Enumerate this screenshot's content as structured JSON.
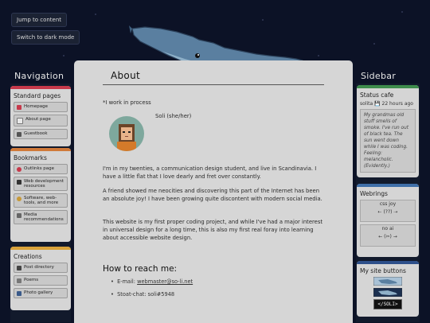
{
  "header": {
    "skip_label": "Jump to content",
    "dark_label": "Switch to dark mode"
  },
  "nav": {
    "title": "Navigation",
    "standard": {
      "title": "Standard pages",
      "items": [
        "Homepage",
        "About page",
        "Guestbook"
      ]
    },
    "bookmarks": {
      "title": "Bookmarks",
      "items": [
        "Outlinks page",
        "Web development resources",
        "Software, web-tools, and more",
        "Media recommendations"
      ]
    },
    "creations": {
      "title": "Creations",
      "items": [
        "Post directory",
        "Poems",
        "Photo gallery"
      ]
    }
  },
  "main": {
    "title": "About",
    "wip": "*I work in process",
    "avatar_caption": "Soli (she/her)",
    "para1": "I'm in my twenties, a communication design student, and live in Scandinavia. I have a little flat that I love dearly and fret over constantly.",
    "para2": "A friend showed me neocities and discovering this part of the Internet has been an absolute joy! I have been growing quite discontent with modern social media.",
    "para3": "This website is my first proper coding project, and while I've had a major interest in universal design for a long time, this is also my first real foray into learning about accessible website design.",
    "reach_title": "How to reach me:",
    "email_prefix": "E-mail: ",
    "email": "webmaster@so-li.net",
    "stoat": "Stoat-chat: soli#5948"
  },
  "sidebar": {
    "title": "Sidebar",
    "status": {
      "title": "Status cafe",
      "user": "solita",
      "time": "22 hours ago",
      "text": "My grandmas old stuff smells of smoke. I've run out of black tea. The sun went down while I was coding. Feeling: melancholic. (Evidently.)"
    },
    "webrings": {
      "title": "Webrings",
      "ring1_name": "css joy",
      "ring1_nav": "⇠ (??) ⇢",
      "ring2_name": "no ai",
      "ring2_nav": "← (✂) →"
    },
    "buttons": {
      "title": "My site buttons",
      "button3_text": "</SOLI>"
    }
  },
  "colors": {
    "background": "#0c1226",
    "card": "#d5d5d5",
    "standard_bar": "#c7394b",
    "bookmarks_bar": "#d07a3a",
    "creations_bar": "#d9a23a",
    "status_bar": "#3e8c4c",
    "webrings_bar": "#3f6fa8",
    "buttons_bar": "#2d4f8a",
    "whale": "#5a7fa0"
  },
  "icons": {
    "homepage": "home-icon",
    "about": "about-icon",
    "guestbook": "guestbook-icon",
    "outlinks": "heart-icon",
    "webdev": "tools-icon",
    "software": "gear-icon",
    "media": "media-icon",
    "posts": "book-icon",
    "poems": "feather-icon",
    "gallery": "photo-icon",
    "status": "save-icon"
  }
}
